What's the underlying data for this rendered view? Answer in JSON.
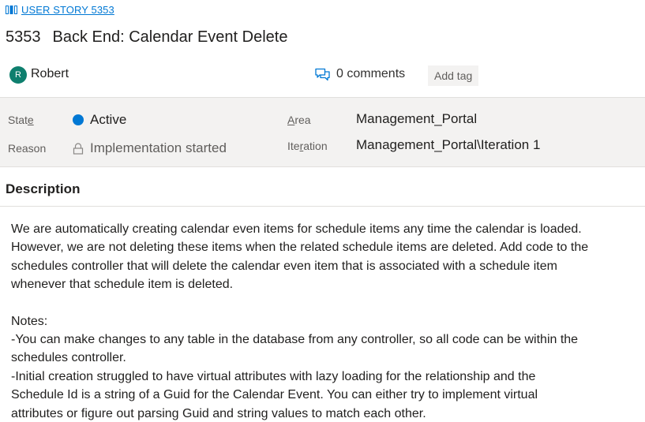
{
  "breadcrumb": {
    "label": "USER STORY 5353",
    "icon": "book-icon"
  },
  "work_item": {
    "id": "5353",
    "title": "Back End: Calendar Event Delete"
  },
  "owner": {
    "initial": "R",
    "name": "Robert",
    "avatar_color": "#0e7f6e"
  },
  "comments": {
    "label": "0 comments",
    "icon": "comment-icon"
  },
  "tags": {
    "add_label": "Add tag"
  },
  "fields": {
    "state_label": "State",
    "state_value": "Active",
    "state_color": "#0078d4",
    "reason_label": "Reason",
    "reason_value": "Implementation started",
    "area_label": "Area",
    "area_value": "Management_Portal",
    "iteration_label": "Iteration",
    "iteration_value": "Management_Portal\\Iteration 1"
  },
  "description": {
    "header": "Description",
    "para1_line1": "We are automatically creating calendar even items for schedule items any time the calendar is loaded.",
    "para1_line2": "However, we are not deleting these items when the related schedule items are deleted. Add code to the",
    "para1_line3": "schedules controller that will delete the calendar even item that is associated with a schedule item",
    "para1_line4": "whenever that schedule item is deleted.",
    "notes_title": "Notes:",
    "note1_line1": "-You can make changes to any table in the database from any controller, so all code can be within the",
    "note1_line2": "schedules controller.",
    "note2_line1": "-Initial creation struggled to have virtual attributes with lazy loading for the relationship and the",
    "note2_line2": "Schedule Id is a string of a Guid for the Calendar Event. You can either try to implement virtual",
    "note2_line3": "attributes or figure out parsing Guid and string values to match each other."
  },
  "colors": {
    "accent": "#0078d4",
    "field_band": "#f3f2f1"
  }
}
